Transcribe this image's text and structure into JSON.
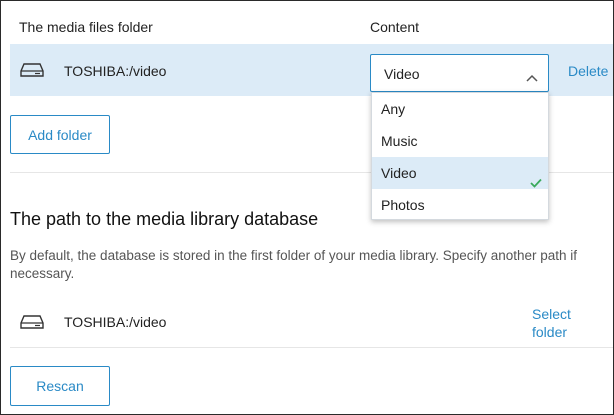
{
  "table": {
    "col_folder": "The media files folder",
    "col_content": "Content"
  },
  "folder_row": {
    "path": "TOSHIBA:/video",
    "content_value": "Video",
    "delete_label": "Delete"
  },
  "dropdown": {
    "options": [
      "Any",
      "Music",
      "Video",
      "Photos"
    ],
    "selected": "Video"
  },
  "add_folder_label": "Add folder",
  "database_section": {
    "title": "The path to the media library database",
    "description": "By default, the database is stored in the first folder of your media library. Specify another path if necessary.",
    "path": "TOSHIBA:/video",
    "select_folder_label": "Select folder"
  },
  "rescan_label": "Rescan",
  "colors": {
    "accent": "#2a8ac6",
    "selected_bg": "#dcebf7",
    "check": "#3aaa5c"
  },
  "icons": {
    "drive": "hard-drive-icon",
    "chevron": "chevron-up-icon",
    "check": "checkmark-icon"
  }
}
